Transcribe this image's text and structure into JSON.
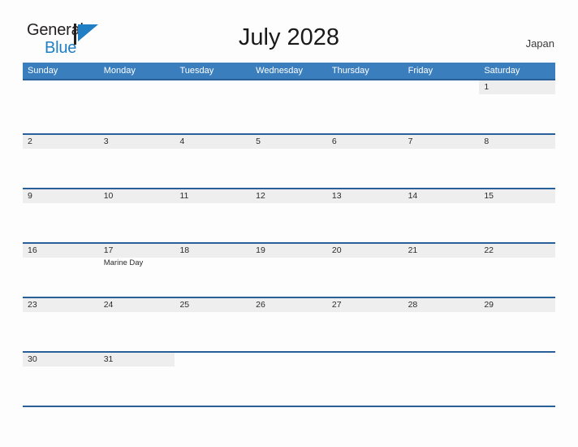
{
  "brand": {
    "name_top": "General",
    "name_bottom": "Blue",
    "flag_color": "#1f7ec4",
    "text_color": "#231f20"
  },
  "header": {
    "title": "July 2028",
    "country": "Japan"
  },
  "theme": {
    "header_blue": "#3a7ebe",
    "rule_blue": "#2a6099",
    "band_gray": "#eeeeee",
    "page_bg": "#fdfdfd",
    "text": "#2b2b2b"
  },
  "calendar": {
    "weekdays": [
      "Sunday",
      "Monday",
      "Tuesday",
      "Wednesday",
      "Thursday",
      "Friday",
      "Saturday"
    ],
    "weeks": [
      [
        {
          "day": "",
          "events": []
        },
        {
          "day": "",
          "events": []
        },
        {
          "day": "",
          "events": []
        },
        {
          "day": "",
          "events": []
        },
        {
          "day": "",
          "events": []
        },
        {
          "day": "",
          "events": []
        },
        {
          "day": "1",
          "events": []
        }
      ],
      [
        {
          "day": "2",
          "events": []
        },
        {
          "day": "3",
          "events": []
        },
        {
          "day": "4",
          "events": []
        },
        {
          "day": "5",
          "events": []
        },
        {
          "day": "6",
          "events": []
        },
        {
          "day": "7",
          "events": []
        },
        {
          "day": "8",
          "events": []
        }
      ],
      [
        {
          "day": "9",
          "events": []
        },
        {
          "day": "10",
          "events": []
        },
        {
          "day": "11",
          "events": []
        },
        {
          "day": "12",
          "events": []
        },
        {
          "day": "13",
          "events": []
        },
        {
          "day": "14",
          "events": []
        },
        {
          "day": "15",
          "events": []
        }
      ],
      [
        {
          "day": "16",
          "events": []
        },
        {
          "day": "17",
          "events": [
            "Marine Day"
          ]
        },
        {
          "day": "18",
          "events": []
        },
        {
          "day": "19",
          "events": []
        },
        {
          "day": "20",
          "events": []
        },
        {
          "day": "21",
          "events": []
        },
        {
          "day": "22",
          "events": []
        }
      ],
      [
        {
          "day": "23",
          "events": []
        },
        {
          "day": "24",
          "events": []
        },
        {
          "day": "25",
          "events": []
        },
        {
          "day": "26",
          "events": []
        },
        {
          "day": "27",
          "events": []
        },
        {
          "day": "28",
          "events": []
        },
        {
          "day": "29",
          "events": []
        }
      ],
      [
        {
          "day": "30",
          "events": []
        },
        {
          "day": "31",
          "events": []
        },
        {
          "day": "",
          "events": []
        },
        {
          "day": "",
          "events": []
        },
        {
          "day": "",
          "events": []
        },
        {
          "day": "",
          "events": []
        },
        {
          "day": "",
          "events": []
        }
      ]
    ]
  }
}
